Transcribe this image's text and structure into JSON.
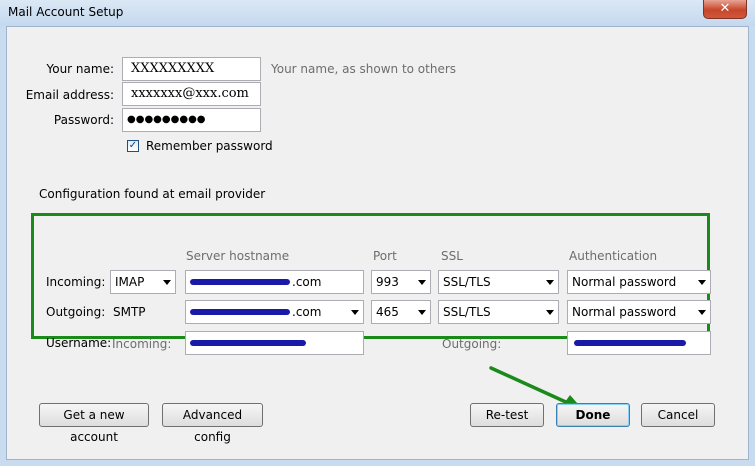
{
  "window": {
    "title": "Mail Account Setup",
    "close_glyph": "✕"
  },
  "form": {
    "name_label": "Your name:",
    "name_value": "XXXXXXXXX",
    "name_hint": "Your name, as shown to others",
    "email_label": "Email address:",
    "email_value": "xxxxxxx@xxx.com",
    "password_label": "Password:",
    "password_value": "●●●●●●●●●",
    "remember_label": "Remember password",
    "remember_checked": true,
    "status_text": "Configuration found at email provider"
  },
  "config": {
    "headers": {
      "hostname": "Server hostname",
      "port": "Port",
      "ssl": "SSL",
      "auth": "Authentication"
    },
    "incoming": {
      "label": "Incoming:",
      "protocol": "IMAP",
      "hostname_suffix": ".com",
      "port": "993",
      "ssl": "SSL/TLS",
      "auth": "Normal password"
    },
    "outgoing": {
      "label": "Outgoing:",
      "protocol": "SMTP",
      "hostname_suffix": ".com",
      "port": "465",
      "ssl": "SSL/TLS",
      "auth": "Normal password"
    },
    "username": {
      "label": "Username:",
      "incoming_label": "Incoming:",
      "outgoing_label": "Outgoing:"
    }
  },
  "buttons": {
    "new_account": "Get a new account",
    "advanced": "Advanced config",
    "retest": "Re-test",
    "done": "Done",
    "cancel": "Cancel"
  },
  "colors": {
    "highlight_box": "#1a8a1a",
    "arrow": "#1a8a1a",
    "redaction": "#1a1aa8"
  }
}
